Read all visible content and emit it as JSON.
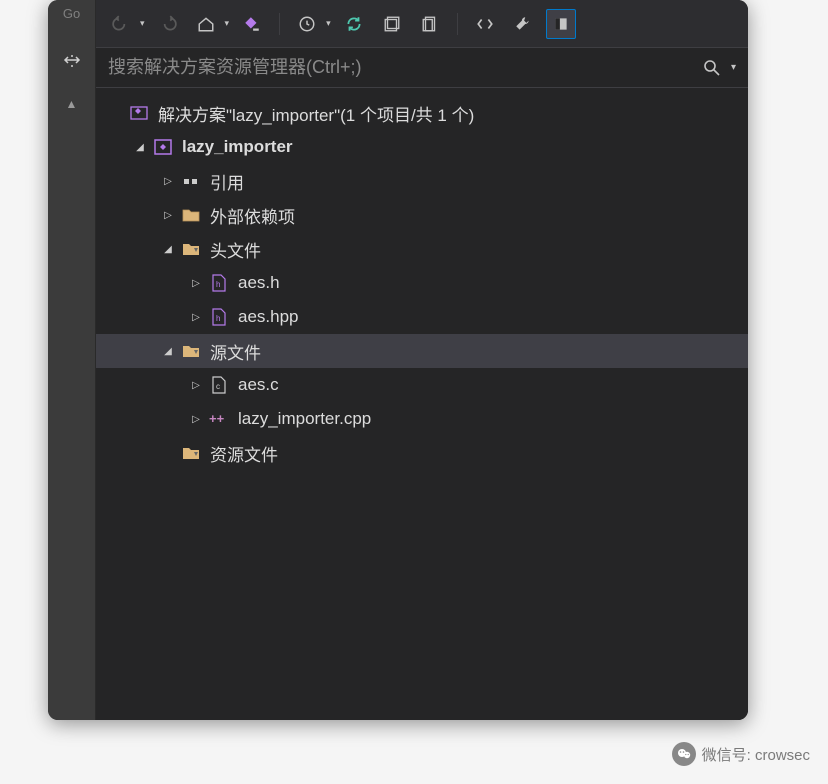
{
  "search": {
    "placeholder": "搜索解决方案资源管理器(Ctrl+;)"
  },
  "tree": {
    "solution_label": "解决方案\"lazy_importer\"(1 个项目/共 1 个)",
    "project_label": "lazy_importer",
    "references_label": "引用",
    "external_deps_label": "外部依赖项",
    "headers_label": "头文件",
    "aes_h": "aes.h",
    "aes_hpp": "aes.hpp",
    "sources_label": "源文件",
    "aes_c": "aes.c",
    "lazy_importer_cpp": "lazy_importer.cpp",
    "resources_label": "资源文件"
  },
  "footer": {
    "wechat_label": "微信号: crowsec"
  },
  "left": {
    "go": "Go"
  }
}
